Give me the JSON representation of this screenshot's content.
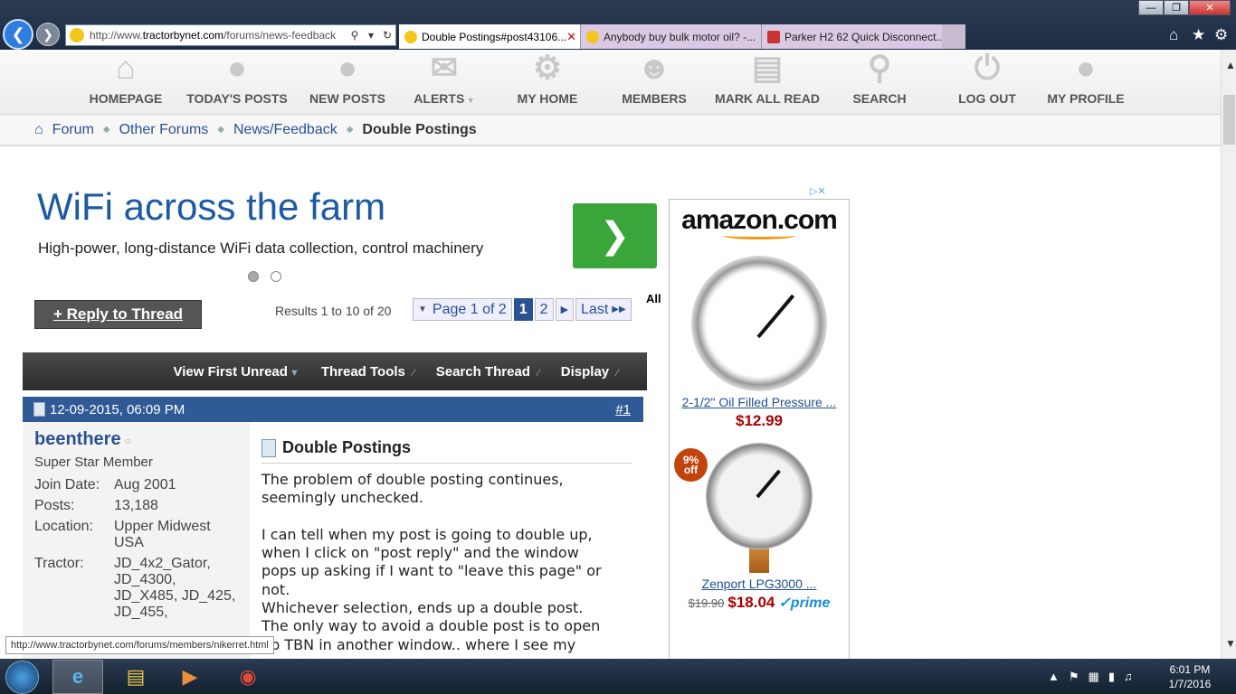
{
  "browser": {
    "url_prefix": "http://www.",
    "url_domain": "tractorbynet.com",
    "url_path": "/forums/news-feedback",
    "tabs": [
      {
        "label": "Double Postings#post43106..."
      },
      {
        "label": "Anybody buy bulk motor oil? -..."
      },
      {
        "label": "Parker H2 62 Quick Disconnect..."
      }
    ]
  },
  "nav": {
    "items": [
      {
        "label": "HOMEPAGE"
      },
      {
        "label": "TODAY'S POSTS"
      },
      {
        "label": "NEW POSTS"
      },
      {
        "label": "ALERTS"
      },
      {
        "label": "MY HOME"
      },
      {
        "label": "MEMBERS"
      },
      {
        "label": "MARK ALL READ"
      },
      {
        "label": "SEARCH"
      },
      {
        "label": "LOG OUT"
      },
      {
        "label": "MY PROFILE"
      }
    ]
  },
  "breadcrumb": {
    "items": [
      "Forum",
      "Other Forums",
      "News/Feedback"
    ],
    "current": "Double Postings"
  },
  "ad": {
    "title": "WiFi across the farm",
    "subtitle": "High-power, long-distance WiFi data collection, control machinery"
  },
  "thread": {
    "reply_label": "+ Reply to Thread",
    "results": "Results 1 to 10 of 20",
    "pager": {
      "page_label": "Page 1 of 2",
      "p1": "1",
      "p2": "2",
      "last": "Last"
    },
    "all_label": "All",
    "tools": [
      "View First Unread",
      "Thread Tools",
      "Search Thread",
      "Display"
    ]
  },
  "post": {
    "date": "12-09-2015, 06:09 PM",
    "number": "#1",
    "username": "beenthere",
    "user_title": "Super Star Member",
    "info": [
      {
        "key": "Join Date:",
        "value": "Aug 2001"
      },
      {
        "key": "Posts:",
        "value": "13,188"
      },
      {
        "key": "Location:",
        "value": "Upper Midwest USA"
      },
      {
        "key": "Tractor:",
        "value": "JD_4x2_Gator, JD_4300, JD_X485, JD_425, JD_455,"
      }
    ],
    "title": "Double Postings",
    "body": "The problem of double posting continues,\nseemingly unchecked.\n\nI can tell when my post is going to double up,\nwhen I click on \"post reply\" and the window\npops up asking if I want to \"leave this page\" or\nnot.\nWhichever selection, ends up a double post.\nThe only way to avoid a double post is to open\nup TBN in another window.. where I see my"
  },
  "amazon": {
    "logo": "amazon.com",
    "products": [
      {
        "name": "2-1/2\" Oil Filled Pressure ...",
        "price": "$12.99"
      },
      {
        "name": "Zenport LPG3000 ...",
        "old_price": "$19.90",
        "price": "$18.04",
        "badge": "prime",
        "discount_pct": "9%",
        "discount_word": "off"
      }
    ]
  },
  "status_url": "http://www.tractorbynet.com/forums/members/nikerret.html",
  "clock": {
    "time": "6:01 PM",
    "date": "1/7/2016"
  }
}
